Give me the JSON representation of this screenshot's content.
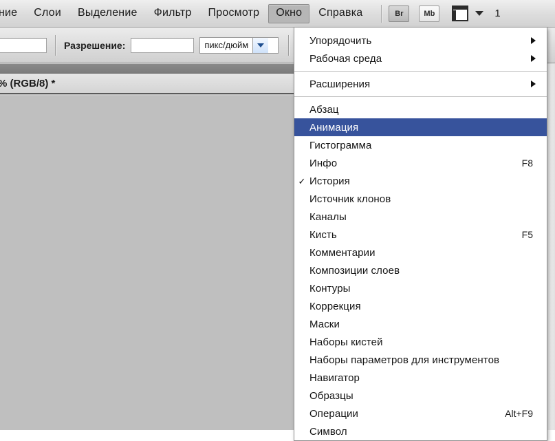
{
  "menubar": {
    "items": [
      {
        "label": "ние",
        "active": false,
        "truncated": true
      },
      {
        "label": "Слои",
        "active": false
      },
      {
        "label": "Выделение",
        "active": false
      },
      {
        "label": "Фильтр",
        "active": false
      },
      {
        "label": "Просмотр",
        "active": false
      },
      {
        "label": "Окно",
        "active": true
      },
      {
        "label": "Справка",
        "active": false
      }
    ],
    "bridge_button": "Br",
    "minibridge_button": "Mb",
    "screen_mode_icon": "screen-mode-icon",
    "right_truncated_text": "1"
  },
  "options_bar": {
    "resolution_label": "Разрешение:",
    "resolution_value": "",
    "resolution_placeholder": "",
    "width_value": "",
    "units_selected": "пикс/дюйм"
  },
  "document": {
    "tab_title": "% (RGB/8) *"
  },
  "menu": {
    "title": "Окно",
    "groups": [
      {
        "items": [
          {
            "label": "Упорядочить",
            "submenu": true
          },
          {
            "label": "Рабочая среда",
            "submenu": true
          }
        ]
      },
      {
        "items": [
          {
            "label": "Расширения",
            "submenu": true
          }
        ]
      },
      {
        "items": [
          {
            "label": "Абзац"
          },
          {
            "label": "Анимация",
            "highlighted": true
          },
          {
            "label": "Гистограмма"
          },
          {
            "label": "Инфо",
            "shortcut": "F8"
          },
          {
            "label": "История",
            "checked": true
          },
          {
            "label": "Источник клонов"
          },
          {
            "label": "Каналы"
          },
          {
            "label": "Кисть",
            "shortcut": "F5"
          },
          {
            "label": "Комментарии"
          },
          {
            "label": "Композиции слоев"
          },
          {
            "label": "Контуры"
          },
          {
            "label": "Коррекция"
          },
          {
            "label": "Маски"
          },
          {
            "label": "Наборы кистей"
          },
          {
            "label": "Наборы параметров для инструментов"
          },
          {
            "label": "Навигатор"
          },
          {
            "label": "Образцы"
          },
          {
            "label": "Операции",
            "shortcut": "Alt+F9"
          },
          {
            "label": "Символ"
          }
        ]
      }
    ]
  },
  "colors": {
    "highlight": "#37539c",
    "canvas": "#bfbfbf",
    "chrome": "#dcdcdc",
    "menu_bg": "#ffffff"
  }
}
